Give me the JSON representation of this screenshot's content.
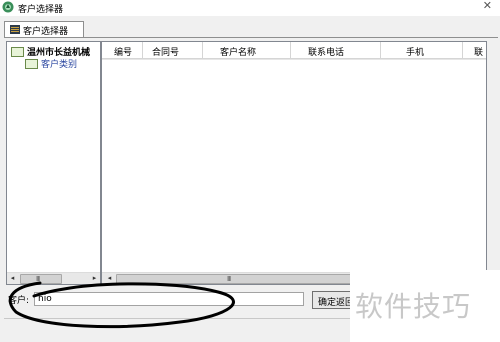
{
  "window": {
    "title": "客户选择器",
    "close_glyph": "✕"
  },
  "tabs": [
    {
      "label": "客户选择器",
      "active": true
    }
  ],
  "tree": {
    "root_label": "温州市长益机械",
    "child_label": "客户类别"
  },
  "grid": {
    "columns": [
      "编号",
      "合同号",
      "客户名称",
      "联系电话",
      "手机",
      "联"
    ]
  },
  "scrollbar": {
    "left_arrow": "◂",
    "right_arrow": "▸",
    "grip": "III"
  },
  "customer": {
    "label": "客户:",
    "value": "nio"
  },
  "buttons": {
    "ok_label": "确定返回"
  },
  "watermark": "软件技巧",
  "colors": {
    "annotation_stroke": "#000000",
    "tree_root_text": "#000000",
    "tree_child_text": "#2a46a0"
  }
}
